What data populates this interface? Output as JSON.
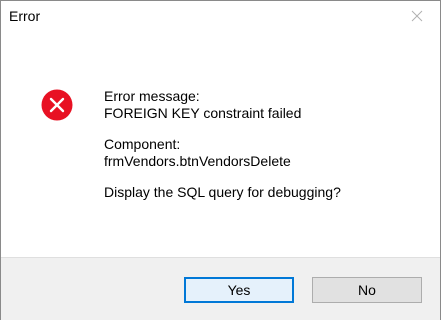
{
  "window": {
    "title": "Error"
  },
  "icons": {
    "close": "close-icon",
    "error": "error-icon"
  },
  "colors": {
    "error_red": "#e81123",
    "accent_blue": "#0078d7",
    "footer_bg": "#f0f0f0"
  },
  "message": {
    "error_heading": "Error message:",
    "error_text": "FOREIGN KEY constraint failed",
    "component_heading": "Component:",
    "component_text": "frmVendors.btnVendorsDelete",
    "question": "Display the SQL query for debugging?"
  },
  "buttons": {
    "yes_label": "Yes",
    "no_label": "No"
  }
}
